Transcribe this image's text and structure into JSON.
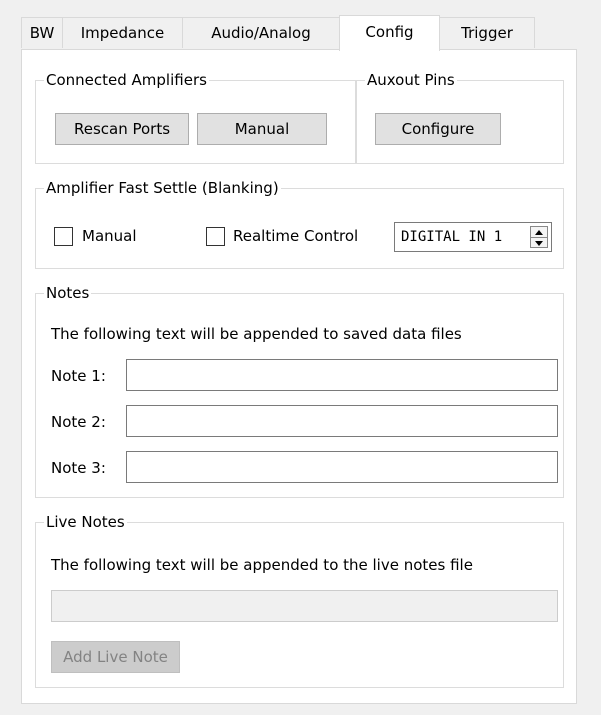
{
  "tabs": [
    {
      "label": "BW"
    },
    {
      "label": "Impedance"
    },
    {
      "label": "Audio/Analog"
    },
    {
      "label": "Config",
      "active": true
    },
    {
      "label": "Trigger"
    }
  ],
  "connected_amplifiers": {
    "title": "Connected Amplifiers",
    "rescan_label": "Rescan Ports",
    "manual_label": "Manual"
  },
  "auxout_pins": {
    "title": "Auxout Pins",
    "configure_label": "Configure"
  },
  "fast_settle": {
    "title": "Amplifier Fast Settle (Blanking)",
    "manual_label": "Manual",
    "manual_checked": false,
    "realtime_label": "Realtime Control",
    "realtime_checked": false,
    "digital_input_value": "DIGITAL IN 1"
  },
  "notes": {
    "title": "Notes",
    "description": "The following text will be appended to saved data files",
    "items": [
      {
        "label": "Note 1:",
        "value": ""
      },
      {
        "label": "Note 2:",
        "value": ""
      },
      {
        "label": "Note 3:",
        "value": ""
      }
    ]
  },
  "live_notes": {
    "title": "Live Notes",
    "description": "The following text will be appended to the live notes file",
    "value": "",
    "add_label": "Add Live Note"
  },
  "colors": {
    "window_bg": "#f0f0f0",
    "panel_bg": "#ffffff",
    "button_bg": "#e1e1e1",
    "disabled_text": "#838383"
  },
  "icons": {
    "spin_up": "triangle-up-icon",
    "spin_down": "triangle-down-icon"
  }
}
